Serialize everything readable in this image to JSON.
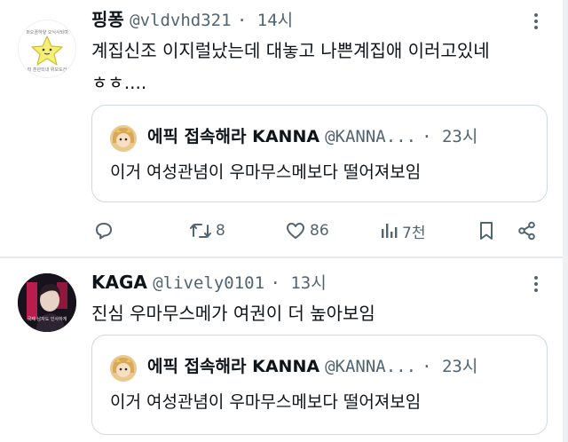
{
  "tweets": [
    {
      "display_name": "핑퐁",
      "handle": "@vldvhd321",
      "time": "· 14시",
      "text_lines": [
        "계집신조 이지럴났는데 대놓고 나쁜계집애 이러고있네",
        "ㅎㅎ...."
      ],
      "avatar_caption_top": "퍼오끔하얗 오닉사되며",
      "avatar_caption_bottom": "퍼 훈관되내 위보도건",
      "quote": {
        "display_name": "에픽 접속해라 KANNA",
        "handle": "@KANNA...",
        "time": "· 23시",
        "text": "이거 여성관념이 우마무스메보다 떨어져보임"
      },
      "actions": {
        "reply_icon": "reply-icon",
        "retweet_count": "8",
        "like_count": "86",
        "views_count": "7천",
        "bookmark_icon": "bookmark-icon",
        "share_icon": "share-icon"
      }
    },
    {
      "display_name": "KAGA",
      "handle": "@lively0101",
      "time": "· 13시",
      "text": "진심 우마무스메가 여권이 더 높아보임",
      "avatar_caption": "국제 남자도 인사하게",
      "quote": {
        "display_name": "에픽 접속해라 KANNA",
        "handle": "@KANNA...",
        "time": "· 23시",
        "text": "이거 여성관념이 우마무스메보다 떨어져보임"
      }
    }
  ],
  "colors": {
    "text": "#0f1419",
    "secondary": "#536471",
    "border": "#cfd9de",
    "star": "#f5ef78"
  }
}
